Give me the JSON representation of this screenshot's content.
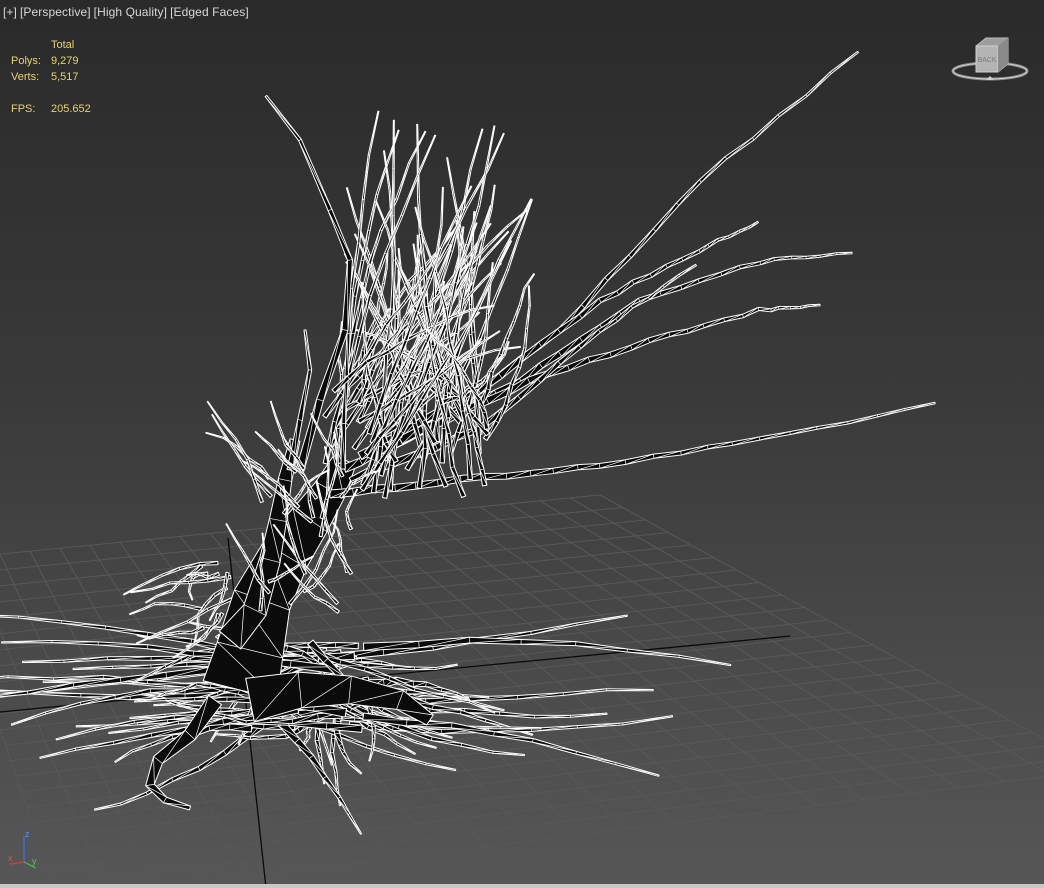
{
  "viewport_label": {
    "plus": "[+]",
    "view": "[Perspective]",
    "shading": "[High Quality]",
    "edges": "[Edged Faces]"
  },
  "stats": {
    "header": "Total",
    "polys_label": "Polys:",
    "polys_value": "9,279",
    "verts_label": "Verts:",
    "verts_value": "5,517",
    "fps_label": "FPS:",
    "fps_value": "205.652"
  },
  "viewcube": {
    "face": "BACK"
  },
  "axis": {
    "z": "z",
    "y": "y",
    "x": "x"
  },
  "colors": {
    "stats_text": "#e8d36a",
    "wire": "#ffffff",
    "mesh_fill": "#0b0b0b",
    "grid": "#555555",
    "grid_axis": "#000000"
  }
}
